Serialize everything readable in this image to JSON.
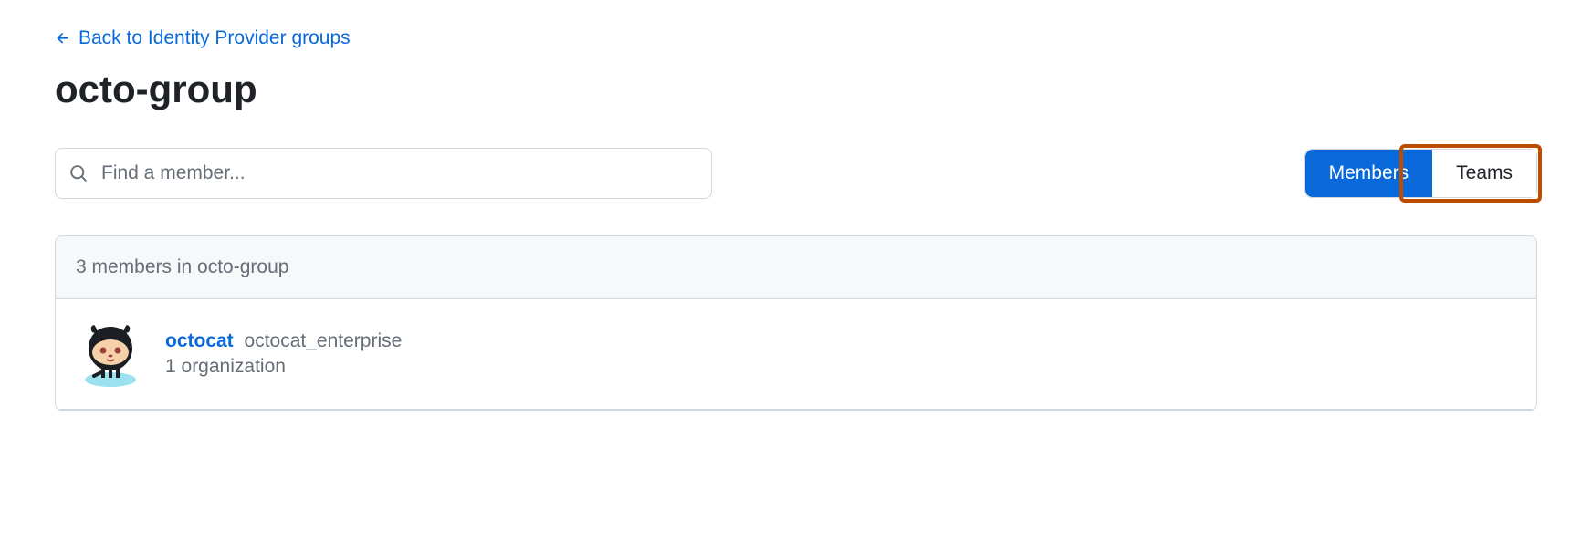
{
  "back_link": {
    "label": "Back to Identity Provider groups"
  },
  "page_title": "octo-group",
  "search": {
    "placeholder": "Find a member..."
  },
  "toggle": {
    "members": "Members",
    "teams": "Teams"
  },
  "list": {
    "header": "3 members in octo-group",
    "members": [
      {
        "username": "octocat",
        "fullname": "octocat_enterprise",
        "meta": "1 organization"
      }
    ]
  }
}
